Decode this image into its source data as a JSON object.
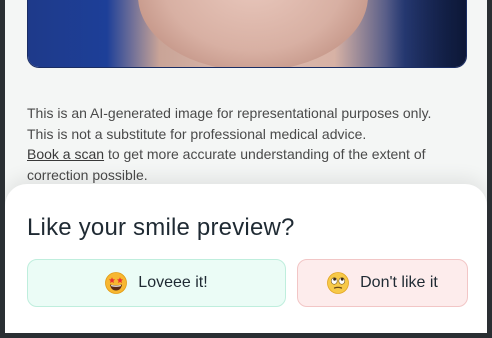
{
  "disclaimer": {
    "line1": "This is an AI-generated image for representational purposes only.",
    "line2": "This is not a substitute for professional medical advice.",
    "link_text": "Book a scan",
    "line3_rest": " to get more accurate understanding of the extent of",
    "line4": "correction possible."
  },
  "preview_sheet": {
    "title": "Like your smile preview?",
    "love_label": "Loveee it!",
    "love_icon": "star-struck-emoji-icon",
    "dislike_label": "Don't like it",
    "dislike_icon": "eye-roll-emoji-icon",
    "love_bg": "#ebfcf6",
    "dislike_bg": "#fdecec"
  }
}
